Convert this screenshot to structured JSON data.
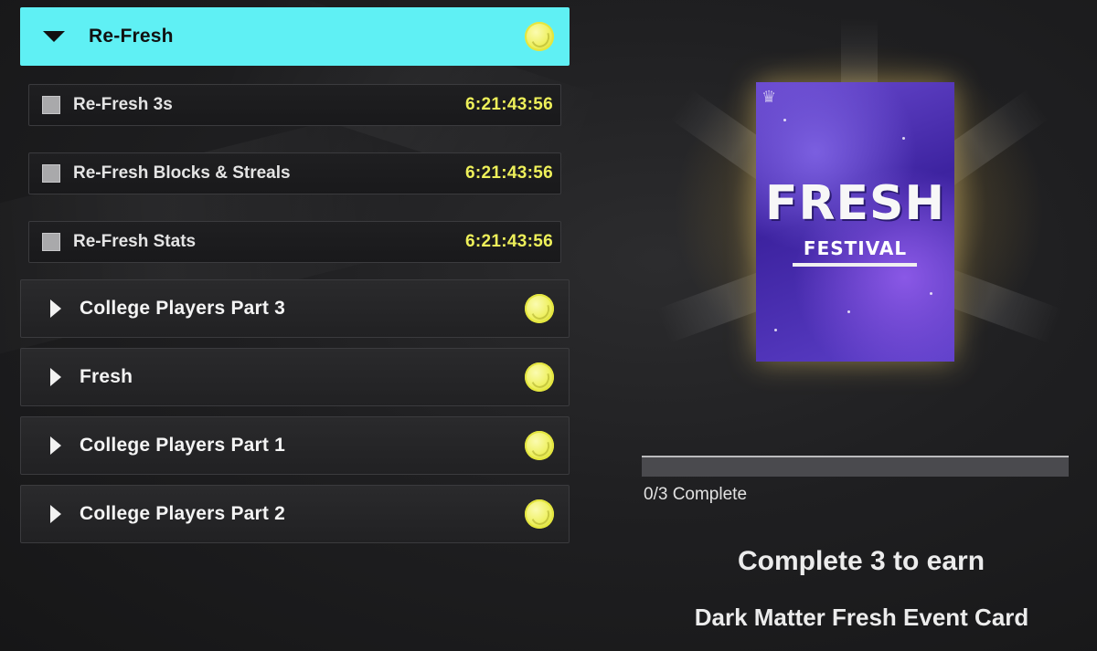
{
  "groups": [
    {
      "label": "Re-Fresh",
      "expanded": true
    },
    {
      "label": "College Players Part 3",
      "expanded": false
    },
    {
      "label": "Fresh",
      "expanded": false
    },
    {
      "label": "College Players Part 1",
      "expanded": false
    },
    {
      "label": "College Players Part 2",
      "expanded": false
    }
  ],
  "agendas": [
    {
      "label": "Re-Fresh 3s",
      "timer": "6:21:43:56",
      "checked": false
    },
    {
      "label": "Re-Fresh Blocks & Streals",
      "timer": "6:21:43:56",
      "checked": false
    },
    {
      "label": "Re-Fresh Stats",
      "timer": "6:21:43:56",
      "checked": false
    }
  ],
  "reward": {
    "card_title": "FRESH",
    "card_subtitle": "FESTIVAL",
    "progress_text": "0/3 Complete",
    "progress_fraction": 0,
    "earn_text": "Complete 3 to earn",
    "reward_name": "Dark Matter Fresh Event Card"
  },
  "colors": {
    "active_header": "#5ff0f4",
    "timer": "#eef05a",
    "coin": "#eef05e"
  },
  "icons": [
    "caret-down-icon",
    "caret-right-icon",
    "basketball-coin-icon",
    "checkbox-icon"
  ]
}
